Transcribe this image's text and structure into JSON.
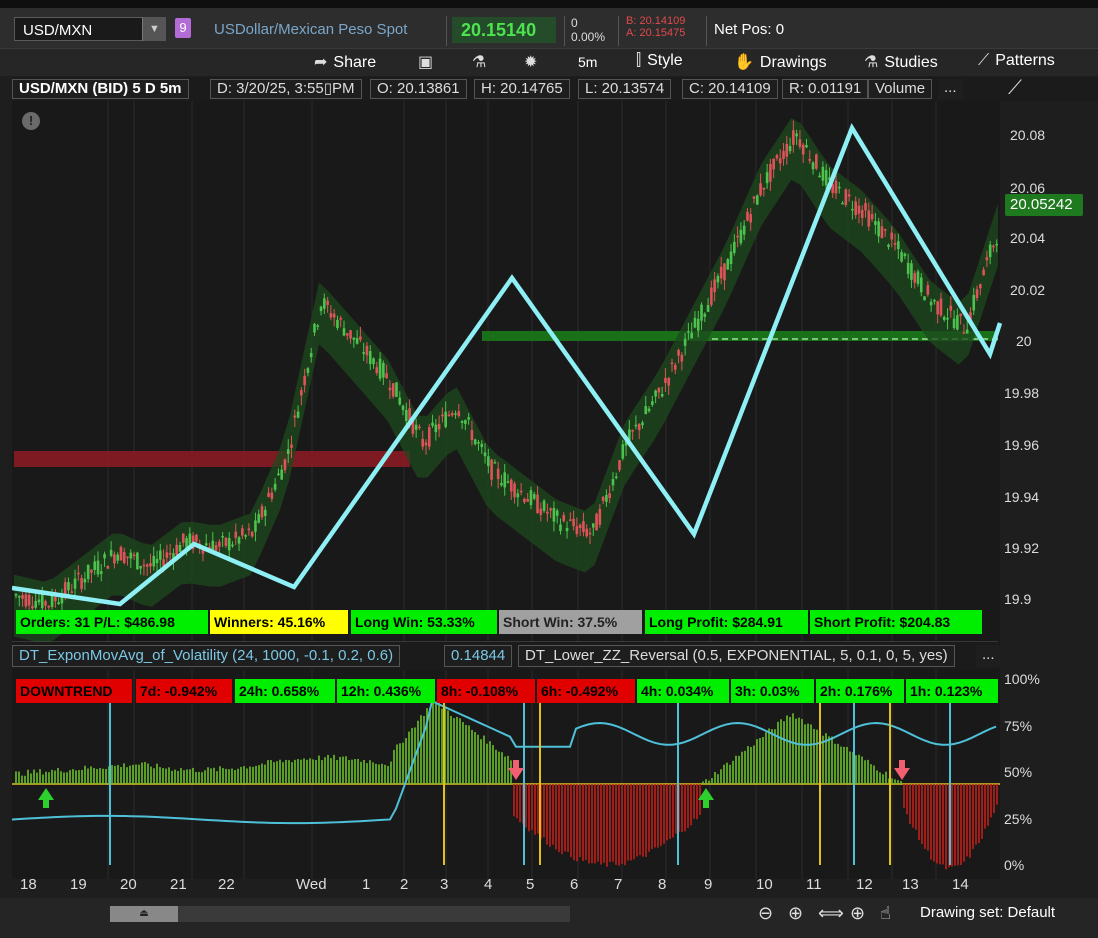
{
  "header": {
    "symbol": "USD/MXN",
    "badge": "9",
    "description": "USDollar/Mexican Peso Spot",
    "last_price": "20.15140",
    "change": "0",
    "change_pct": "0.00%",
    "bid": "B: 20.14109",
    "ask": "A: 20.15475",
    "net_pos": "Net Pos: 0"
  },
  "toolbar": {
    "share": "Share",
    "interval": "5m",
    "style": "Style",
    "drawings": "Drawings",
    "studies": "Studies",
    "patterns": "Patterns"
  },
  "infobar": {
    "title": "USD/MXN (BID) 5 D 5m",
    "date": "D: 3/20/25, 3:55▯PM",
    "open": "O: 20.13861",
    "high": "H: 20.14765",
    "low": "L: 20.13574",
    "close": "C: 20.14109",
    "range": "R: 0.01191",
    "volume": "Volume",
    "more": "..."
  },
  "price_tag": "20.05242",
  "price_axis": [
    "20.08",
    "20.06",
    "20.04",
    "20.02",
    "20",
    "19.98",
    "19.96",
    "19.94",
    "19.92",
    "19.9"
  ],
  "stats": {
    "orders": "Orders: 31 P/L: $486.98",
    "winners": "Winners: 45.16%",
    "long_win": "Long Win: 53.33%",
    "short_win": "Short Win: 37.5%",
    "long_profit": "Long Profit: $284.91",
    "short_profit": "Short Profit: $204.83"
  },
  "lower_study": {
    "name": "DT_ExponMovAvg_of_Volatility (24, 1000, -0.1, 0.2, 0.6)",
    "value": "0.14844",
    "zz": "DT_Lower_ZZ_Reversal (0.5, EXPONENTIAL, 5, 0.1, 0, 5, yes)",
    "more": "..."
  },
  "timeframes": [
    {
      "label": "DOWNTREND",
      "status": "red"
    },
    {
      "label": "7d: -0.942%",
      "status": "red"
    },
    {
      "label": "24h: 0.658%",
      "status": "green"
    },
    {
      "label": "12h: 0.436%",
      "status": "green"
    },
    {
      "label": "8h: -0.108%",
      "status": "red"
    },
    {
      "label": "6h: -0.492%",
      "status": "red"
    },
    {
      "label": "4h: 0.034%",
      "status": "green"
    },
    {
      "label": "3h: 0.03%",
      "status": "green"
    },
    {
      "label": "2h: 0.176%",
      "status": "green"
    },
    {
      "label": "1h: 0.123%",
      "status": "green"
    }
  ],
  "lower_axis": [
    "100%",
    "75%",
    "50%",
    "25%",
    "0%"
  ],
  "time_axis": [
    "18",
    "19",
    "20",
    "21",
    "22",
    "Wed",
    "1",
    "2",
    "3",
    "4",
    "5",
    "6",
    "7",
    "8",
    "9",
    "10",
    "11",
    "12",
    "13",
    "14"
  ],
  "bottom": {
    "drawing_set": "Drawing set: Default"
  },
  "colors": {
    "up": "#4ec24e",
    "down": "#e0525a",
    "zigzag": "#8ef0f5",
    "stat_green": "#00ee00",
    "stat_yellow": "#ffff00",
    "stat_gray": "#a0a0a0"
  },
  "icons": [
    "share-icon",
    "screenshot-icon",
    "flask-icon",
    "gear-icon",
    "style-icon",
    "drawings-icon",
    "studies-icon",
    "patterns-icon",
    "info-icon",
    "zoom-out-icon",
    "zoom-in-icon",
    "pan-icon",
    "crosshair-icon",
    "hand-icon"
  ],
  "chart_data": {
    "type": "candlestick",
    "series": [
      {
        "name": "",
        "values": [
          [
            0,
            19.901
          ],
          [
            6,
            19.898
          ],
          [
            12,
            19.908
          ],
          [
            18,
            19.918
          ],
          [
            24,
            19.912
          ],
          [
            30,
            19.922
          ],
          [
            36,
            19.92
          ],
          [
            42,
            19.925
          ],
          [
            48,
            19.955
          ],
          [
            54,
            20.015
          ],
          [
            60,
            20.0
          ],
          [
            66,
            19.985
          ],
          [
            72,
            19.96
          ],
          [
            78,
            19.975
          ],
          [
            84,
            19.95
          ],
          [
            90,
            19.94
          ],
          [
            96,
            19.93
          ],
          [
            102,
            19.925
          ],
          [
            108,
            19.96
          ],
          [
            114,
            19.98
          ],
          [
            120,
            20.005
          ],
          [
            126,
            20.03
          ],
          [
            132,
            20.06
          ],
          [
            138,
            20.08
          ],
          [
            144,
            20.06
          ],
          [
            150,
            20.05
          ],
          [
            156,
            20.035
          ],
          [
            162,
            20.015
          ],
          [
            168,
            20.005
          ],
          [
            174,
            20.045
          ]
        ]
      }
    ],
    "ylim": [
      19.895,
      20.085
    ]
  }
}
